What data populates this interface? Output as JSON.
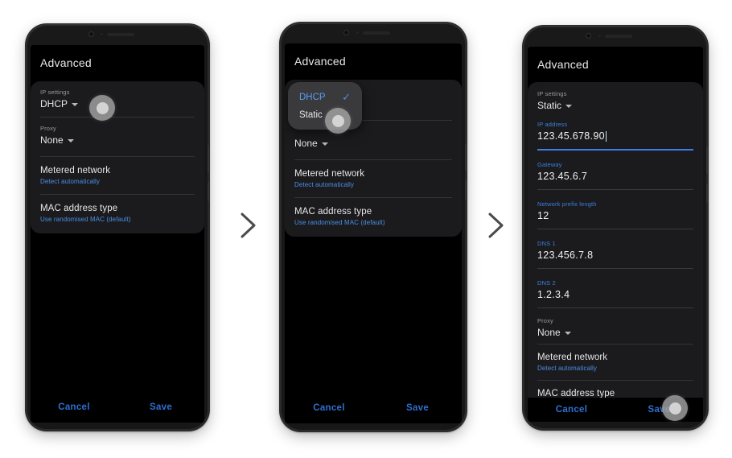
{
  "screen_title": "Advanced",
  "colors": {
    "accent_blue": "#3b7fe0",
    "link_blue": "#4a8fe7",
    "action_blue": "#2f6fd0",
    "card_bg": "#1b1b1d",
    "screen_bg": "#000000",
    "dropdown_bg": "#3a3a3c"
  },
  "actions": {
    "cancel_label": "Cancel",
    "save_label": "Save"
  },
  "labels": {
    "ip_settings": "IP settings",
    "proxy": "Proxy",
    "ip_address": "IP address",
    "gateway": "Gateway",
    "network_prefix_length": "Network prefix length",
    "dns1": "DNS 1",
    "dns2": "DNS 2"
  },
  "rows": {
    "metered_network_title": "Metered network",
    "metered_network_sub": "Detect automatically",
    "mac_address_title": "MAC address type",
    "mac_address_sub": "Use randomised MAC (default)"
  },
  "options": {
    "dhcp": "DHCP",
    "static": "Static",
    "none": "None",
    "check_glyph": "✓"
  },
  "step1": {
    "ip_settings_value": "DHCP",
    "proxy_value": "None"
  },
  "step2": {
    "dropdown_items": [
      {
        "label": "DHCP",
        "selected": true
      },
      {
        "label": "Static",
        "selected": false
      }
    ],
    "proxy_value": "None"
  },
  "step3": {
    "ip_settings_value": "Static",
    "ip_address_value": "123.45.678.90",
    "gateway_value": "123.45.6.7",
    "network_prefix_length_value": "12",
    "dns1_value": "123.456.7.8",
    "dns2_value": "1.2.3.4",
    "proxy_value": "None"
  },
  "separators": {
    "chevron_glyph": "›"
  }
}
